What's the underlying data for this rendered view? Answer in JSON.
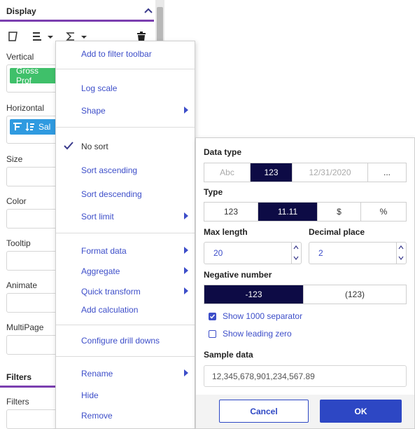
{
  "panel": {
    "display_header": "Display",
    "fields": {
      "vertical": "Vertical",
      "vertical_chip": "Gross Prof",
      "horizontal": "Horizontal",
      "horizontal_chip": "Sal",
      "size": "Size",
      "color": "Color",
      "tooltip": "Tooltip",
      "animate": "Animate",
      "multipage": "MultiPage"
    },
    "filters_header": "Filters",
    "filters_label": "Filters",
    "colors": {
      "accent_line": "#7b3fb0",
      "vertical_chip": "#3fc06a",
      "horizontal_chip": "#2f9ae0"
    }
  },
  "menu": {
    "add_filter": "Add to filter toolbar",
    "log_scale": "Log scale",
    "shape": "Shape",
    "no_sort": "No sort",
    "sort_asc": "Sort ascending",
    "sort_desc": "Sort descending",
    "sort_limit": "Sort limit",
    "format_data": "Format data",
    "aggregate": "Aggregate",
    "quick_transform": "Quick transform",
    "add_calculation": "Add calculation",
    "drill_downs": "Configure drill downs",
    "rename": "Rename",
    "hide": "Hide",
    "remove": "Remove",
    "link_color": "#3d4ec9"
  },
  "format": {
    "data_type_label": "Data type",
    "data_types": [
      "Abc",
      "123",
      "12/31/2020",
      "..."
    ],
    "data_type_selected": "123",
    "type_label": "Type",
    "types": [
      "123",
      "11.11",
      "$",
      "%"
    ],
    "type_selected": "11.11",
    "max_length_label": "Max length",
    "max_length_value": "20",
    "decimal_place_label": "Decimal place",
    "decimal_place_value": "2",
    "negative_label": "Negative number",
    "negative_options": [
      "-123",
      "(123)"
    ],
    "negative_selected": "-123",
    "show_separator": "Show 1000 separator",
    "show_separator_checked": true,
    "show_leading_zero": "Show leading zero",
    "show_leading_zero_checked": false,
    "sample_label": "Sample data",
    "sample_value": "12,345,678,901,234,567.89",
    "cancel": "Cancel",
    "ok": "OK",
    "selected_color": "#0d0b45",
    "primary_color": "#2d47c4"
  }
}
